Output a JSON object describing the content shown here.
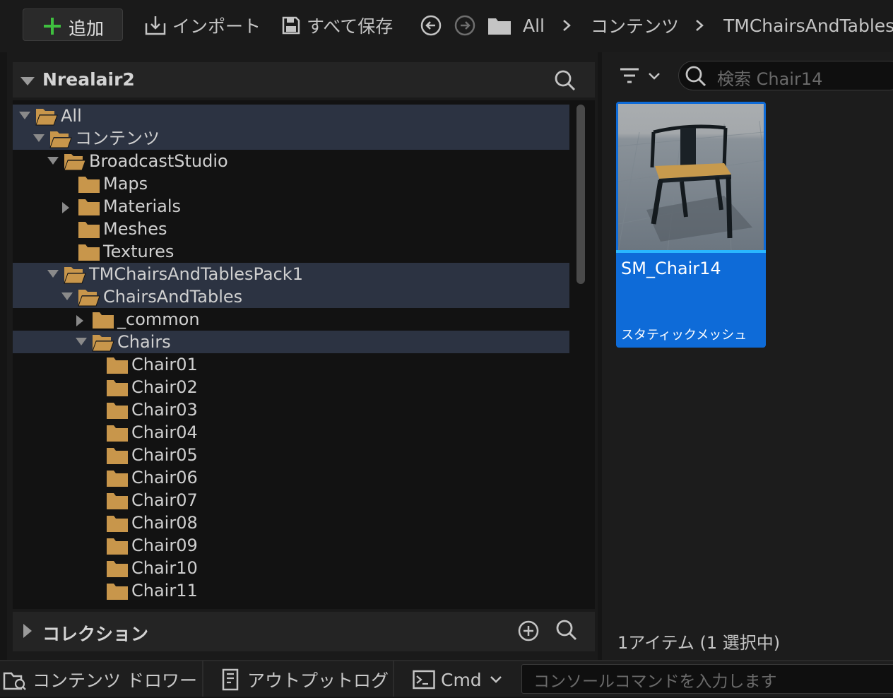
{
  "toolbar": {
    "add_label": "追加",
    "import_label": "インポート",
    "save_all_label": "すべて保存",
    "breadcrumb": [
      "All",
      "コンテンツ",
      "TMChairsAndTablesP"
    ]
  },
  "sources": {
    "title": "Nrealair2",
    "tree": [
      {
        "label": "All",
        "depth": 0,
        "expanded": true,
        "selected": true,
        "arrow": true
      },
      {
        "label": "コンテンツ",
        "depth": 1,
        "expanded": true,
        "selected": true,
        "arrow": true
      },
      {
        "label": "BroadcastStudio",
        "depth": 2,
        "expanded": true,
        "selected": false,
        "arrow": true
      },
      {
        "label": "Maps",
        "depth": 3,
        "expanded": false,
        "selected": false,
        "arrow": false
      },
      {
        "label": "Materials",
        "depth": 3,
        "expanded": false,
        "selected": false,
        "arrow": true
      },
      {
        "label": "Meshes",
        "depth": 3,
        "expanded": false,
        "selected": false,
        "arrow": false
      },
      {
        "label": "Textures",
        "depth": 3,
        "expanded": false,
        "selected": false,
        "arrow": false
      },
      {
        "label": "TMChairsAndTablesPack1",
        "depth": 2,
        "expanded": true,
        "selected": true,
        "arrow": true
      },
      {
        "label": "ChairsAndTables",
        "depth": 3,
        "expanded": true,
        "selected": true,
        "arrow": true
      },
      {
        "label": "_common",
        "depth": 4,
        "expanded": false,
        "selected": false,
        "arrow": true
      },
      {
        "label": "Chairs",
        "depth": 4,
        "expanded": true,
        "selected": true,
        "arrow": true
      },
      {
        "label": "Chair01",
        "depth": 5,
        "expanded": false,
        "selected": false,
        "arrow": false
      },
      {
        "label": "Chair02",
        "depth": 5,
        "expanded": false,
        "selected": false,
        "arrow": false
      },
      {
        "label": "Chair03",
        "depth": 5,
        "expanded": false,
        "selected": false,
        "arrow": false
      },
      {
        "label": "Chair04",
        "depth": 5,
        "expanded": false,
        "selected": false,
        "arrow": false
      },
      {
        "label": "Chair05",
        "depth": 5,
        "expanded": false,
        "selected": false,
        "arrow": false
      },
      {
        "label": "Chair06",
        "depth": 5,
        "expanded": false,
        "selected": false,
        "arrow": false
      },
      {
        "label": "Chair07",
        "depth": 5,
        "expanded": false,
        "selected": false,
        "arrow": false
      },
      {
        "label": "Chair08",
        "depth": 5,
        "expanded": false,
        "selected": false,
        "arrow": false
      },
      {
        "label": "Chair09",
        "depth": 5,
        "expanded": false,
        "selected": false,
        "arrow": false
      },
      {
        "label": "Chair10",
        "depth": 5,
        "expanded": false,
        "selected": false,
        "arrow": false
      },
      {
        "label": "Chair11",
        "depth": 5,
        "expanded": false,
        "selected": false,
        "arrow": false
      }
    ],
    "collections_label": "コレクション"
  },
  "content": {
    "search_placeholder": "検索 Chair14",
    "asset": {
      "name": "SM_Chair14",
      "type": "スタティックメッシュ"
    },
    "status": "1アイテム (1 選択中)"
  },
  "bottom": {
    "drawer_label": "コンテンツ ドロワー",
    "output_log_label": "アウトプットログ",
    "cmd_label": "Cmd",
    "console_placeholder": "コンソールコマンドを入力します"
  },
  "colors": {
    "accent": "#0e6bd8",
    "folder": "#c8964b",
    "selected_row": "#2c3342",
    "add_icon": "#3fbf3f"
  }
}
